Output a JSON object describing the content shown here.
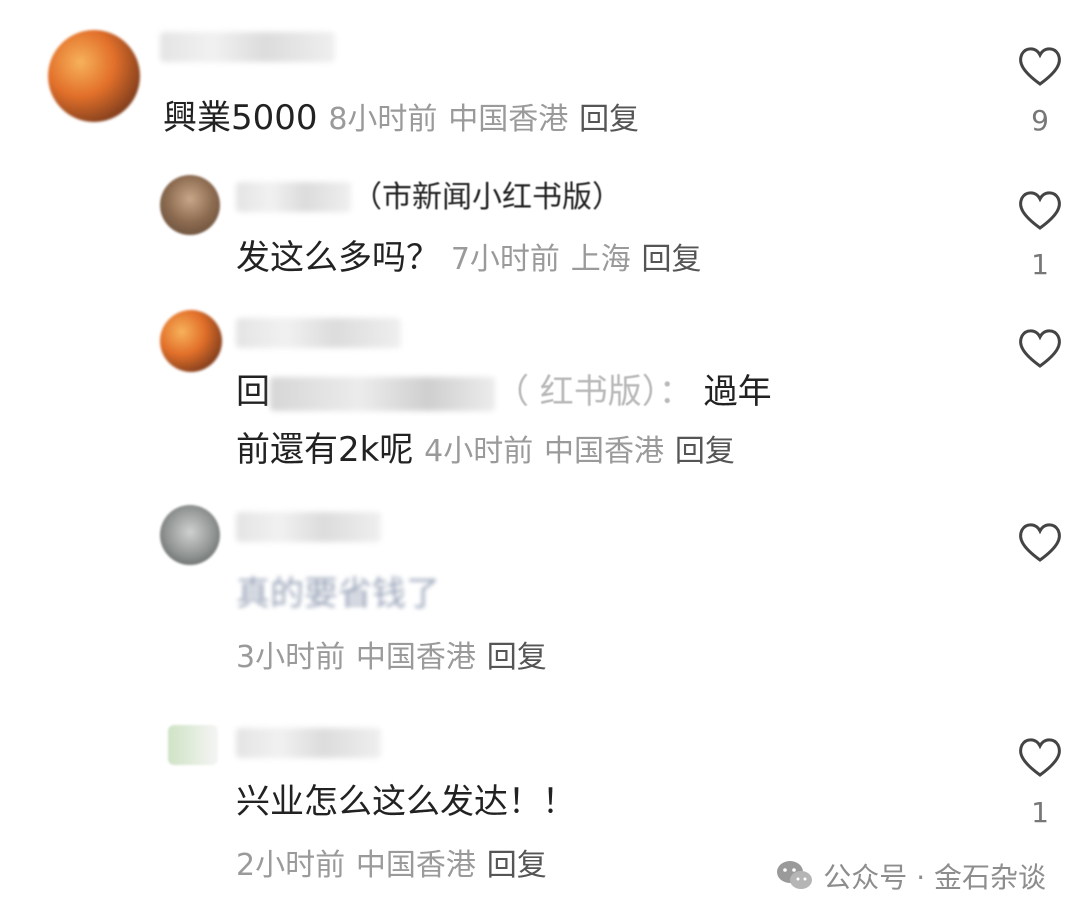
{
  "comments": [
    {
      "text": "興業5000",
      "time": "8小时前",
      "location": "中国香港",
      "reply_label": "回复",
      "likes": "9"
    },
    {
      "name_suffix": "（市新闻小红书版）",
      "text": "发这么多吗？",
      "time": "7小时前",
      "location": "上海",
      "reply_label": "回复",
      "likes": "1"
    },
    {
      "reply_prefix": "回",
      "reply_target_suffix": "（ 红书版）：",
      "text_line1": "過年",
      "text_line2": "前還有2k呢",
      "time": "4小时前",
      "location": "中国香港",
      "reply_label": "回复",
      "likes": ""
    },
    {
      "text": "真的要省钱了",
      "time": "3小时前",
      "location": "中国香港",
      "reply_label": "回复",
      "likes": ""
    },
    {
      "text": "兴业怎么这么发达！！",
      "time": "2小时前",
      "location": "中国香港",
      "reply_label": "回复",
      "likes": "1"
    }
  ],
  "watermark": {
    "icon": "wechat-icon",
    "text": "公众号 · 金石杂谈"
  }
}
